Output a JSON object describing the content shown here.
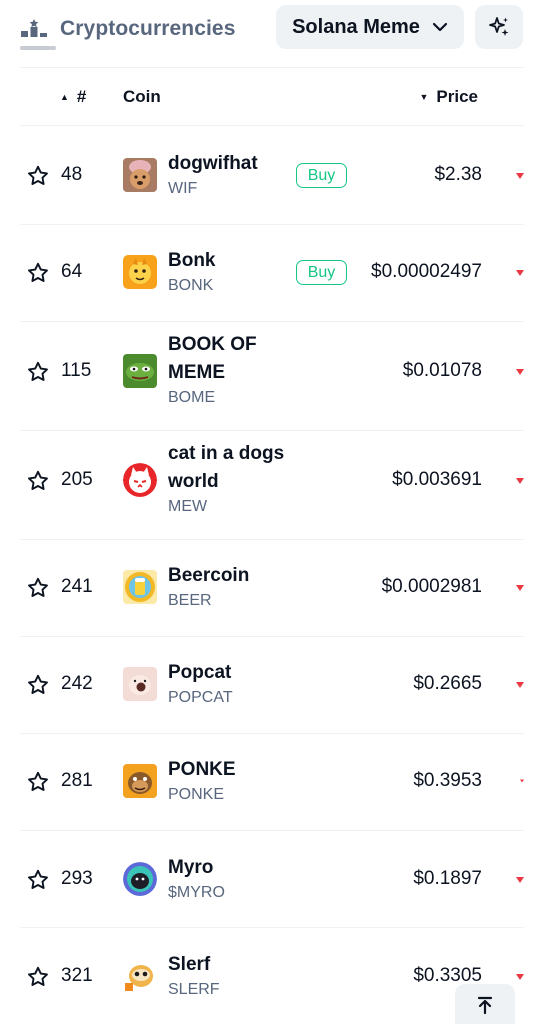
{
  "top_bar": {
    "category_label": "Cryptocurrencies",
    "chip_label": "Solana Meme"
  },
  "table_header": {
    "rank": "#",
    "coin": "Coin",
    "price": "Price"
  },
  "rows": [
    {
      "rank": "48",
      "name_lines": [
        "dogwifhat"
      ],
      "symbol": "WIF",
      "buy": "Buy",
      "price": "$2.38"
    },
    {
      "rank": "64",
      "name_lines": [
        "Bonk"
      ],
      "symbol": "BONK",
      "buy": "Buy",
      "price": "$0.00002497"
    },
    {
      "rank": "115",
      "name_lines": [
        "BOOK OF",
        "MEME"
      ],
      "symbol": "BOME",
      "price": "$0.01078"
    },
    {
      "rank": "205",
      "name_lines": [
        "cat in a dogs",
        "world"
      ],
      "symbol": "MEW",
      "price": "$0.003691"
    },
    {
      "rank": "241",
      "name_lines": [
        "Beercoin"
      ],
      "symbol": "BEER",
      "price": "$0.0002981"
    },
    {
      "rank": "242",
      "name_lines": [
        "Popcat"
      ],
      "symbol": "POPCAT",
      "price": "$0.2665"
    },
    {
      "rank": "281",
      "name_lines": [
        "PONKE"
      ],
      "symbol": "PONKE",
      "price": "$0.3953"
    },
    {
      "rank": "293",
      "name_lines": [
        "Myro"
      ],
      "symbol": "$MYRO",
      "price": "$0.1897"
    },
    {
      "rank": "321",
      "name_lines": [
        "Slerf"
      ],
      "symbol": "SLERF",
      "price": "$0.3305"
    }
  ],
  "colors": {
    "buy_green": "#16c784",
    "down_red": "#ea3943",
    "muted_text": "#58667e"
  }
}
